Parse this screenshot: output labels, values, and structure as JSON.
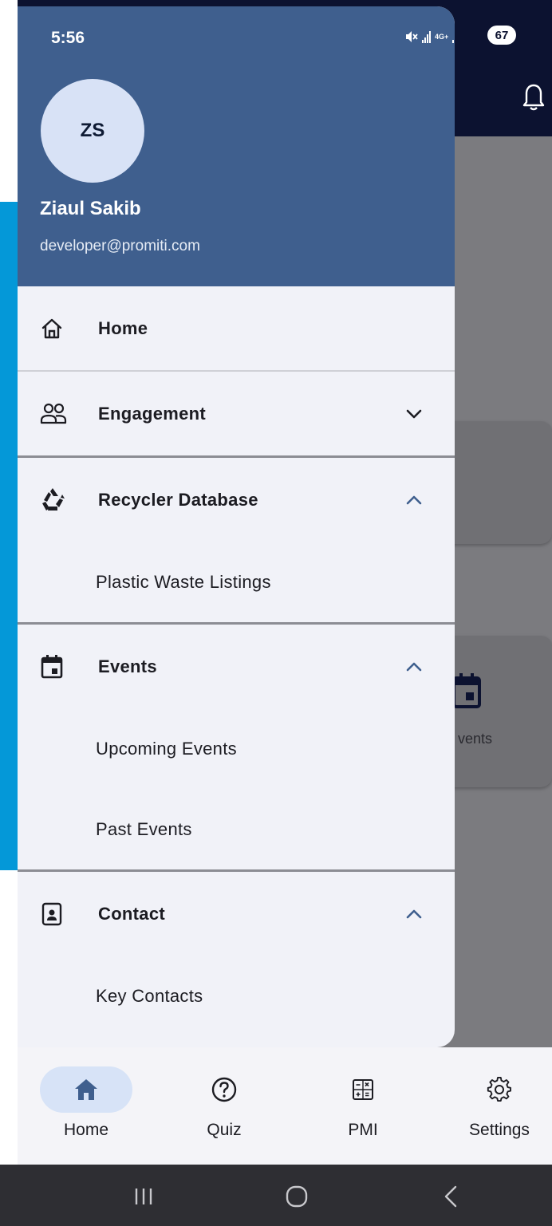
{
  "status_bar": {
    "time": "5:56",
    "network": "4G+",
    "battery": "67"
  },
  "profile": {
    "initials": "ZS",
    "name": "Ziaul Sakib",
    "email": "developer@promiti.com"
  },
  "menu": {
    "home": "Home",
    "engagement": "Engagement",
    "recycler_database": "Recycler Database",
    "plastic_waste_listings": "Plastic Waste Listings",
    "events": "Events",
    "upcoming_events": "Upcoming Events",
    "past_events": "Past Events",
    "contact": "Contact",
    "key_contacts": "Key Contacts"
  },
  "background": {
    "card_label": "vents"
  },
  "bottom_nav": [
    {
      "label": "Home",
      "icon": "home-filled-icon",
      "active": true
    },
    {
      "label": "Quiz",
      "icon": "question-circle-icon",
      "active": false
    },
    {
      "label": "PMI",
      "icon": "calculator-icon",
      "active": false
    },
    {
      "label": "Settings",
      "icon": "gear-icon",
      "active": false
    }
  ],
  "colors": {
    "drawer_header": "#3f5f8e",
    "drawer_bg": "#f1f2f8",
    "app_bar": "#0c1230",
    "scrim": "#7b7b7f",
    "nav_active_pill": "#d7e3f7",
    "accent": "#3f5f8e",
    "edge_blue": "#0498d8"
  }
}
